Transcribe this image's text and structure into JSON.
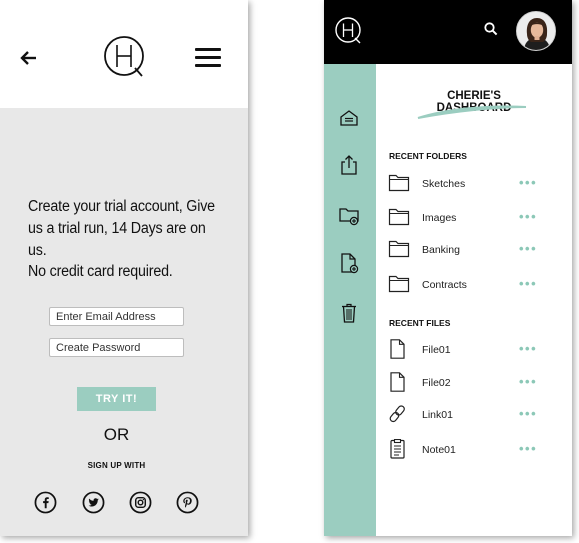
{
  "signup": {
    "trial_message": "Create your trial account, Give us a trial run, 14 Days are on us.",
    "no_card": "No credit card required.",
    "email_placeholder": "Enter Email Address",
    "password_placeholder": "Create Password",
    "try_label": "TRY IT!",
    "or_label": "OR",
    "signup_with": "SIGN UP WITH",
    "social": [
      "facebook-icon",
      "twitter-icon",
      "instagram-icon",
      "pinterest-icon"
    ]
  },
  "dashboard": {
    "title": "CHERIE'S DASHBOARD",
    "recent_folders_heading": "RECENT FOLDERS",
    "recent_files_heading": "RECENT FILES",
    "folders": [
      {
        "label": "Sketches",
        "more": "•••"
      },
      {
        "label": "Images",
        "more": "•••"
      },
      {
        "label": "Banking",
        "more": "•••"
      },
      {
        "label": "Contracts",
        "more": "•••"
      }
    ],
    "files": [
      {
        "label": "File01",
        "icon": "file-icon",
        "more": "•••"
      },
      {
        "label": "File02",
        "icon": "file-icon",
        "more": "•••"
      },
      {
        "label": "Link01",
        "icon": "link-icon",
        "more": "•••"
      },
      {
        "label": "Note01",
        "icon": "clipboard-icon",
        "more": "•••"
      }
    ]
  },
  "colors": {
    "accent": "#9bcdc0",
    "header_dark": "#000000",
    "panel_gray": "#e8e8e8"
  }
}
